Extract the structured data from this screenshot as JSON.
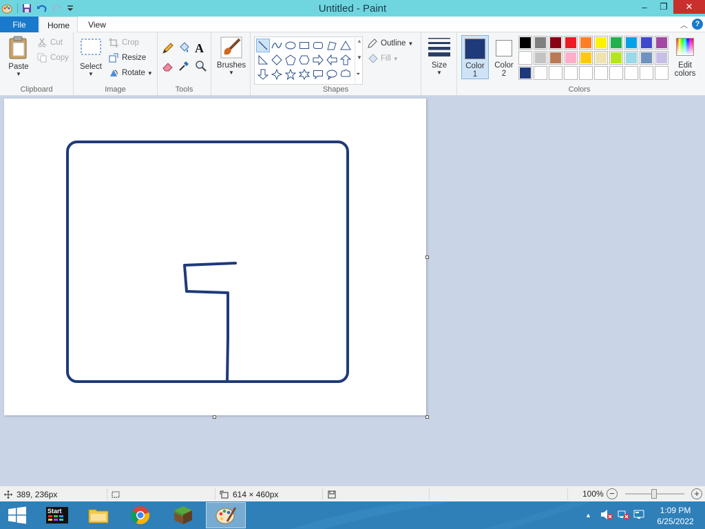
{
  "window": {
    "title": "Untitled - Paint",
    "controls": {
      "minimize": "–",
      "maximize": "❐",
      "close": "✕"
    }
  },
  "tabs": {
    "file": "File",
    "home": "Home",
    "view": "View",
    "help": "?"
  },
  "ribbon": {
    "clipboard": {
      "label": "Clipboard",
      "paste": "Paste",
      "cut": "Cut",
      "copy": "Copy"
    },
    "image": {
      "label": "Image",
      "select": "Select",
      "crop": "Crop",
      "resize": "Resize",
      "rotate": "Rotate"
    },
    "tools": {
      "label": "Tools",
      "text_tool": "A"
    },
    "brushes": {
      "label": "Brushes"
    },
    "shapes": {
      "label": "Shapes",
      "outline": "Outline",
      "fill": "Fill"
    },
    "size": {
      "label": "Size"
    },
    "colors": {
      "label": "Colors",
      "color1_line1": "Color",
      "color1_line2": "1",
      "color2_line1": "Color",
      "color2_line2": "2",
      "edit_line1": "Edit",
      "edit_line2": "colors",
      "color1_value": "#1f3a7a",
      "color2_value": "#ffffff",
      "palette_row1": [
        "#000000",
        "#7f7f7f",
        "#880015",
        "#ed1c24",
        "#ff7f27",
        "#fff200",
        "#22b14c",
        "#00a2e8",
        "#3f48cc",
        "#a349a4"
      ],
      "palette_row2": [
        "#ffffff",
        "#c3c3c3",
        "#b97a57",
        "#ffaec9",
        "#ffc90e",
        "#efe4b0",
        "#b5e61d",
        "#99d9ea",
        "#7092be",
        "#c8bfe7"
      ],
      "palette_row3": [
        "#1f3a7a",
        "#ffffff",
        "#ffffff",
        "#ffffff",
        "#ffffff",
        "#ffffff",
        "#ffffff",
        "#ffffff",
        "#ffffff",
        "#ffffff"
      ]
    }
  },
  "canvas": {
    "stroke_color": "#1f3a7a",
    "background": "#ffffff"
  },
  "status": {
    "cursor_pos": "389, 236px",
    "canvas_size": "614 × 460px",
    "zoom": "100%"
  },
  "taskbar": {
    "start_label": "Start",
    "time": "1:09 PM",
    "date": "6/25/2022"
  }
}
